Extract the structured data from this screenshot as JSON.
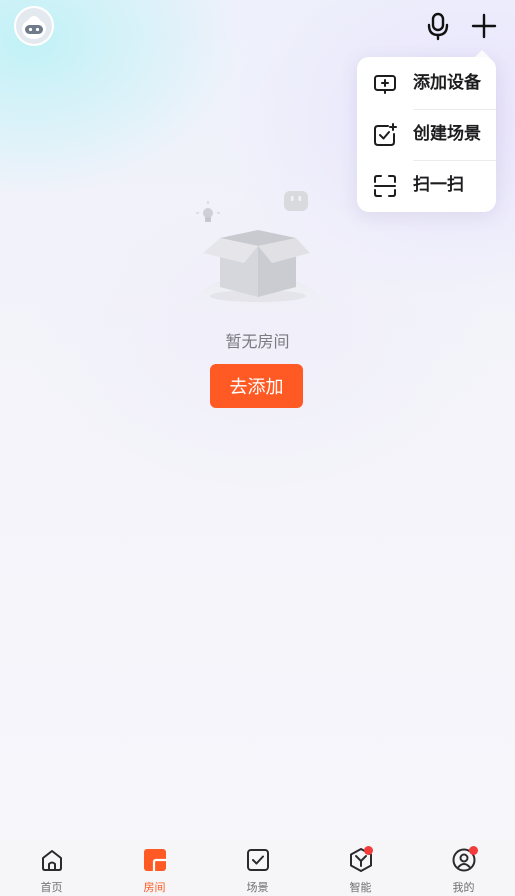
{
  "header": {
    "avatar_icon": "robot-avatar-icon",
    "mic_icon": "microphone-icon",
    "add_icon": "plus-icon"
  },
  "popup_menu": {
    "items": [
      {
        "label": "添加设备",
        "icon": "add-device-icon"
      },
      {
        "label": "创建场景",
        "icon": "create-scene-icon"
      },
      {
        "label": "扫一扫",
        "icon": "scan-icon"
      }
    ]
  },
  "empty_state": {
    "illustration": "empty-box-icon",
    "message": "暂无房间",
    "button_label": "去添加"
  },
  "tabs": [
    {
      "label": "首页",
      "icon": "home-icon",
      "active": false,
      "badge": false
    },
    {
      "label": "房间",
      "icon": "room-icon",
      "active": true,
      "badge": false
    },
    {
      "label": "场景",
      "icon": "scene-checkbox-icon",
      "active": false,
      "badge": false
    },
    {
      "label": "智能",
      "icon": "smart-cube-icon",
      "active": false,
      "badge": true
    },
    {
      "label": "我的",
      "icon": "profile-icon",
      "active": false,
      "badge": true
    }
  ],
  "colors": {
    "accent": "#ff5a23",
    "badge": "#f23b3b",
    "text_primary": "#1d1d1f",
    "text_secondary": "#7a7a80"
  }
}
